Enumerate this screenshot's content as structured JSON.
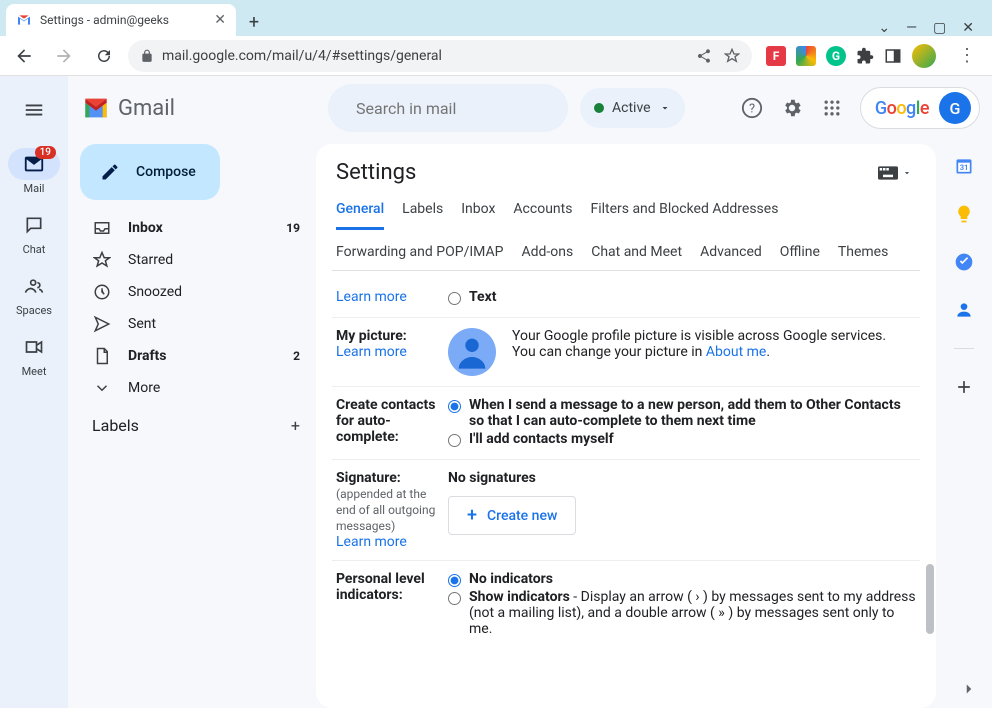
{
  "browser": {
    "tab_title": "Settings - admin@geeks",
    "url": "mail.google.com/mail/u/4/#settings/general"
  },
  "header": {
    "logo_text": "Gmail",
    "search_placeholder": "Search in mail",
    "status_label": "Active",
    "account_initial": "G"
  },
  "rail": {
    "items": [
      {
        "label": "Mail",
        "badge": "19"
      },
      {
        "label": "Chat"
      },
      {
        "label": "Spaces"
      },
      {
        "label": "Meet"
      }
    ]
  },
  "compose_label": "Compose",
  "folders": [
    {
      "label": "Inbox",
      "count": "19",
      "bold": true,
      "icon": "inbox"
    },
    {
      "label": "Starred",
      "icon": "star"
    },
    {
      "label": "Snoozed",
      "icon": "clock"
    },
    {
      "label": "Sent",
      "icon": "send"
    },
    {
      "label": "Drafts",
      "count": "2",
      "bold": true,
      "icon": "file"
    },
    {
      "label": "More",
      "icon": "chevron"
    }
  ],
  "labels_header": "Labels",
  "settings": {
    "title": "Settings",
    "tabs": [
      "General",
      "Labels",
      "Inbox",
      "Accounts",
      "Filters and Blocked Addresses",
      "Forwarding and POP/IMAP",
      "Add-ons",
      "Chat and Meet",
      "Advanced",
      "Offline",
      "Themes"
    ],
    "active_tab": "General",
    "learn_more": "Learn more",
    "rows": {
      "text_option": "Text",
      "my_picture": {
        "label": "My picture:",
        "desc_1": "Your Google profile picture is visible across Google services.",
        "desc_2a": "You can change your picture in ",
        "about_me": "About me",
        "desc_2b": "."
      },
      "contacts": {
        "label": "Create contacts for auto-complete:",
        "opt1": "When I send a message to a new person, add them to Other Contacts so that I can auto-complete to them next time",
        "opt2": "I'll add contacts myself"
      },
      "signature": {
        "label": "Signature:",
        "sub": "(appended at the end of all outgoing messages)",
        "none": "No signatures",
        "create": "Create new"
      },
      "indicators": {
        "label": "Personal level indicators:",
        "opt1": "No indicators",
        "opt2_bold": "Show indicators",
        "opt2_desc": " - Display an arrow ( › ) by messages sent to my address (not a mailing list), and a double arrow ( » ) by messages sent only to me."
      }
    }
  }
}
